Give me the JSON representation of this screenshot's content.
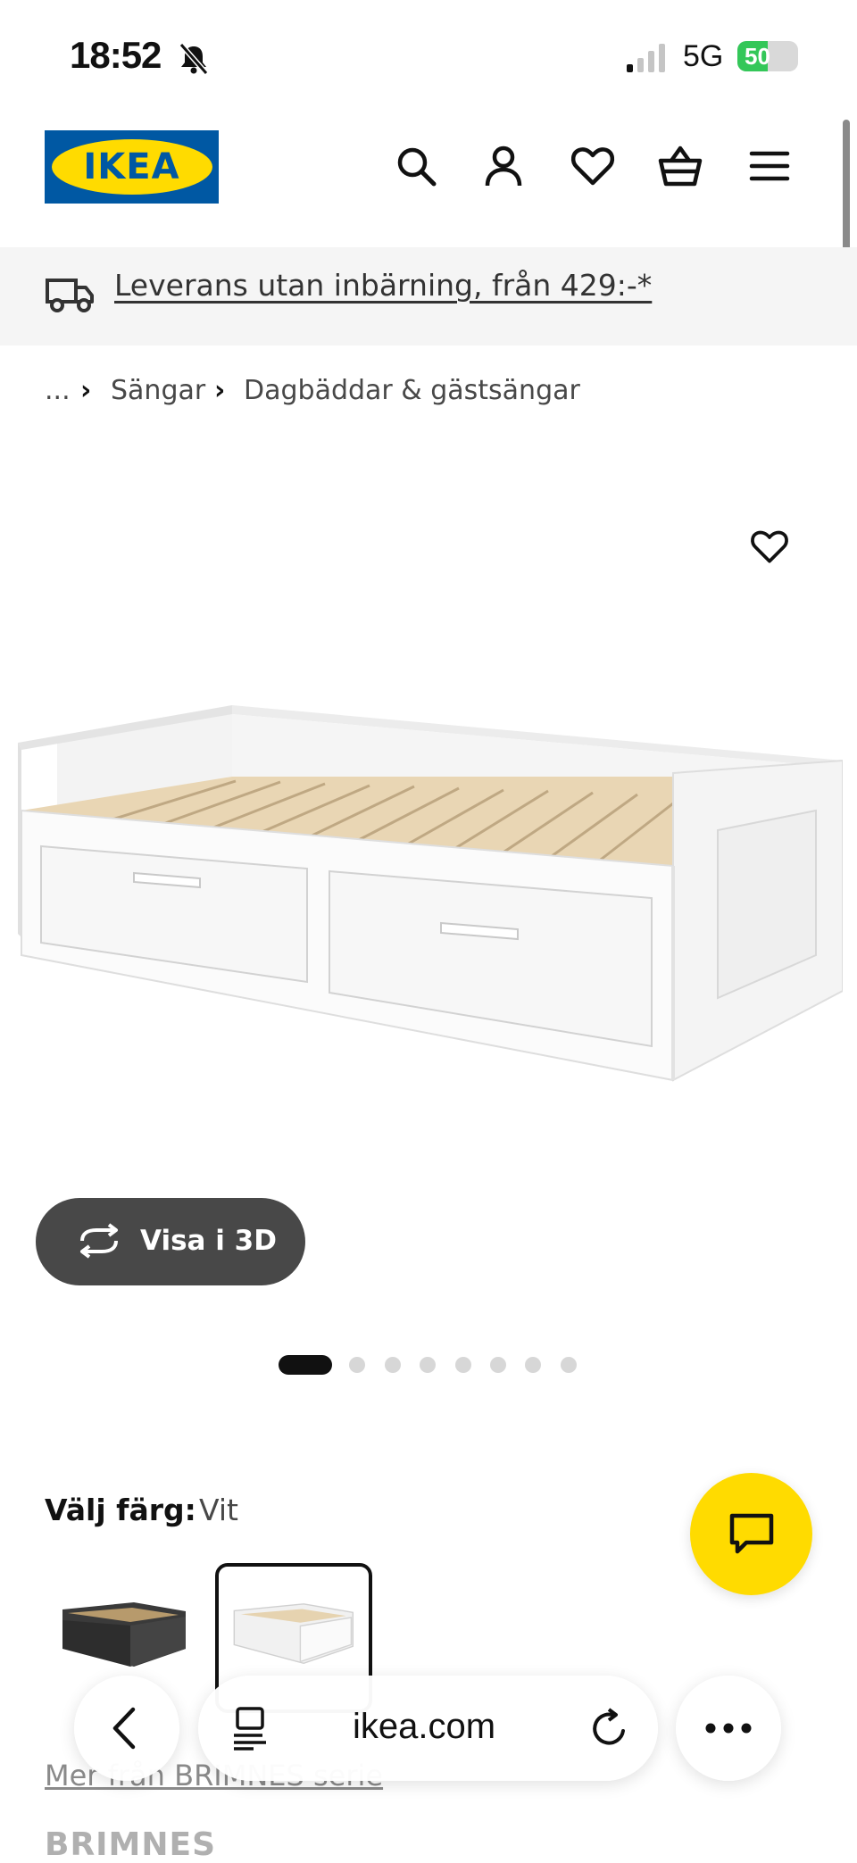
{
  "status_bar": {
    "time": "18:52",
    "network": "5G",
    "battery_percent": "50",
    "battery_level": 0.5,
    "mute_icon": "bell-slash-icon"
  },
  "header": {
    "logo_text": "IKEA",
    "icons": [
      "search-icon",
      "profile-icon",
      "heart-icon",
      "basket-icon",
      "menu-icon"
    ]
  },
  "banner": {
    "text": "Leverans utan inbärning, från 429:-*",
    "icon": "truck-icon"
  },
  "breadcrumb": {
    "ellipsis": "...",
    "items": [
      "Sängar",
      "Dagbäddar & gästsängar"
    ]
  },
  "product_image": {
    "favorite_icon": "heart-outline-icon",
    "view_3d_label": "Visa i 3D",
    "slide_count": 8,
    "active_slide": 1
  },
  "color_picker": {
    "label": "Välj färg:",
    "value": "Vit",
    "swatches": [
      "svart",
      "vit"
    ],
    "selected_index": 1
  },
  "series": {
    "link_text": "Mer från BRIMNES serie",
    "name": "BRIMNES"
  },
  "browser": {
    "url": "ikea.com"
  },
  "colors": {
    "ikea_blue": "#0058a3",
    "ikea_yellow": "#ffdb00",
    "dark_gray": "#484848"
  }
}
